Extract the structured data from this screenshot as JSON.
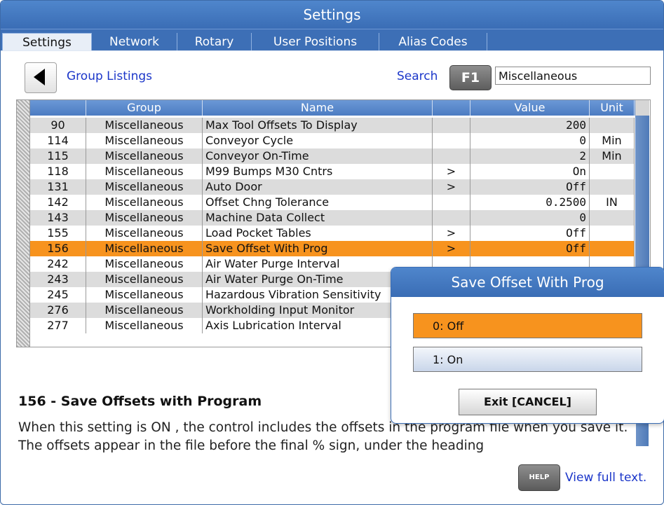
{
  "window": {
    "title": "Settings"
  },
  "tabs": [
    {
      "label": "Settings",
      "active": true
    },
    {
      "label": "Network",
      "active": false
    },
    {
      "label": "Rotary",
      "active": false
    },
    {
      "label": "User Positions",
      "active": false
    },
    {
      "label": "Alias Codes",
      "active": false
    }
  ],
  "toolbar": {
    "back_icon": "left-triangle-icon",
    "group_listings": "Group Listings",
    "search_label": "Search",
    "search_key": "F1",
    "search_value": "Miscellaneous"
  },
  "table": {
    "columns": [
      "",
      "Group",
      "Name",
      "",
      "Value",
      "Unit"
    ],
    "rows": [
      {
        "num": "90",
        "group": "Miscellaneous",
        "name": "Max Tool Offsets To Display",
        "arrow": "",
        "value": "200",
        "unit": ""
      },
      {
        "num": "114",
        "group": "Miscellaneous",
        "name": "Conveyor Cycle",
        "arrow": "",
        "value": "0",
        "unit": "Min"
      },
      {
        "num": "115",
        "group": "Miscellaneous",
        "name": "Conveyor On-Time",
        "arrow": "",
        "value": "2",
        "unit": "Min"
      },
      {
        "num": "118",
        "group": "Miscellaneous",
        "name": "M99 Bumps M30 Cntrs",
        "arrow": ">",
        "value": "On",
        "unit": ""
      },
      {
        "num": "131",
        "group": "Miscellaneous",
        "name": "Auto Door",
        "arrow": ">",
        "value": "Off",
        "unit": ""
      },
      {
        "num": "142",
        "group": "Miscellaneous",
        "name": "Offset Chng Tolerance",
        "arrow": "",
        "value": "0.2500",
        "unit": "IN"
      },
      {
        "num": "143",
        "group": "Miscellaneous",
        "name": "Machine Data Collect",
        "arrow": "",
        "value": "0",
        "unit": ""
      },
      {
        "num": "155",
        "group": "Miscellaneous",
        "name": "Load Pocket Tables",
        "arrow": ">",
        "value": "Off",
        "unit": ""
      },
      {
        "num": "156",
        "group": "Miscellaneous",
        "name": "Save Offset With Prog",
        "arrow": ">",
        "value": "Off",
        "unit": "",
        "selected": true
      },
      {
        "num": "242",
        "group": "Miscellaneous",
        "name": "Air Water Purge Interval",
        "arrow": "",
        "value": "",
        "unit": ""
      },
      {
        "num": "243",
        "group": "Miscellaneous",
        "name": "Air Water Purge On-Time",
        "arrow": "",
        "value": "",
        "unit": ""
      },
      {
        "num": "245",
        "group": "Miscellaneous",
        "name": "Hazardous Vibration Sensitivity",
        "arrow": "",
        "value": "",
        "unit": ""
      },
      {
        "num": "276",
        "group": "Miscellaneous",
        "name": "Workholding Input Monitor",
        "arrow": "",
        "value": "",
        "unit": ""
      },
      {
        "num": "277",
        "group": "Miscellaneous",
        "name": "Axis Lubrication Interval",
        "arrow": "",
        "value": "",
        "unit": ""
      }
    ]
  },
  "description": {
    "title": "156 - Save Offsets with Program",
    "text": "When this setting is ON , the control includes the offsets in the program file when you save it. The offsets appear in the file before the final % sign, under the heading",
    "help_key": "HELP",
    "view_full": "View full text."
  },
  "popup": {
    "title": "Save Offset With Prog",
    "options": [
      "0: Off",
      "1: On"
    ],
    "selected_index": 0,
    "exit_label": "Exit [CANCEL]"
  },
  "colors": {
    "title_bar": "#3a6db5",
    "selection": "#f7931e",
    "link": "#1b36c9"
  }
}
